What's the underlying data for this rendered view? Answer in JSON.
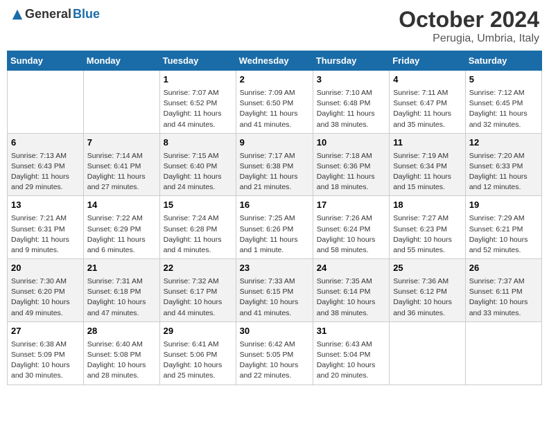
{
  "logo": {
    "general": "General",
    "blue": "Blue"
  },
  "header": {
    "month": "October 2024",
    "location": "Perugia, Umbria, Italy"
  },
  "days_of_week": [
    "Sunday",
    "Monday",
    "Tuesday",
    "Wednesday",
    "Thursday",
    "Friday",
    "Saturday"
  ],
  "weeks": [
    [
      {
        "day": null,
        "info": null
      },
      {
        "day": null,
        "info": null
      },
      {
        "day": "1",
        "info": "Sunrise: 7:07 AM\nSunset: 6:52 PM\nDaylight: 11 hours and 44 minutes."
      },
      {
        "day": "2",
        "info": "Sunrise: 7:09 AM\nSunset: 6:50 PM\nDaylight: 11 hours and 41 minutes."
      },
      {
        "day": "3",
        "info": "Sunrise: 7:10 AM\nSunset: 6:48 PM\nDaylight: 11 hours and 38 minutes."
      },
      {
        "day": "4",
        "info": "Sunrise: 7:11 AM\nSunset: 6:47 PM\nDaylight: 11 hours and 35 minutes."
      },
      {
        "day": "5",
        "info": "Sunrise: 7:12 AM\nSunset: 6:45 PM\nDaylight: 11 hours and 32 minutes."
      }
    ],
    [
      {
        "day": "6",
        "info": "Sunrise: 7:13 AM\nSunset: 6:43 PM\nDaylight: 11 hours and 29 minutes."
      },
      {
        "day": "7",
        "info": "Sunrise: 7:14 AM\nSunset: 6:41 PM\nDaylight: 11 hours and 27 minutes."
      },
      {
        "day": "8",
        "info": "Sunrise: 7:15 AM\nSunset: 6:40 PM\nDaylight: 11 hours and 24 minutes."
      },
      {
        "day": "9",
        "info": "Sunrise: 7:17 AM\nSunset: 6:38 PM\nDaylight: 11 hours and 21 minutes."
      },
      {
        "day": "10",
        "info": "Sunrise: 7:18 AM\nSunset: 6:36 PM\nDaylight: 11 hours and 18 minutes."
      },
      {
        "day": "11",
        "info": "Sunrise: 7:19 AM\nSunset: 6:34 PM\nDaylight: 11 hours and 15 minutes."
      },
      {
        "day": "12",
        "info": "Sunrise: 7:20 AM\nSunset: 6:33 PM\nDaylight: 11 hours and 12 minutes."
      }
    ],
    [
      {
        "day": "13",
        "info": "Sunrise: 7:21 AM\nSunset: 6:31 PM\nDaylight: 11 hours and 9 minutes."
      },
      {
        "day": "14",
        "info": "Sunrise: 7:22 AM\nSunset: 6:29 PM\nDaylight: 11 hours and 6 minutes."
      },
      {
        "day": "15",
        "info": "Sunrise: 7:24 AM\nSunset: 6:28 PM\nDaylight: 11 hours and 4 minutes."
      },
      {
        "day": "16",
        "info": "Sunrise: 7:25 AM\nSunset: 6:26 PM\nDaylight: 11 hours and 1 minute."
      },
      {
        "day": "17",
        "info": "Sunrise: 7:26 AM\nSunset: 6:24 PM\nDaylight: 10 hours and 58 minutes."
      },
      {
        "day": "18",
        "info": "Sunrise: 7:27 AM\nSunset: 6:23 PM\nDaylight: 10 hours and 55 minutes."
      },
      {
        "day": "19",
        "info": "Sunrise: 7:29 AM\nSunset: 6:21 PM\nDaylight: 10 hours and 52 minutes."
      }
    ],
    [
      {
        "day": "20",
        "info": "Sunrise: 7:30 AM\nSunset: 6:20 PM\nDaylight: 10 hours and 49 minutes."
      },
      {
        "day": "21",
        "info": "Sunrise: 7:31 AM\nSunset: 6:18 PM\nDaylight: 10 hours and 47 minutes."
      },
      {
        "day": "22",
        "info": "Sunrise: 7:32 AM\nSunset: 6:17 PM\nDaylight: 10 hours and 44 minutes."
      },
      {
        "day": "23",
        "info": "Sunrise: 7:33 AM\nSunset: 6:15 PM\nDaylight: 10 hours and 41 minutes."
      },
      {
        "day": "24",
        "info": "Sunrise: 7:35 AM\nSunset: 6:14 PM\nDaylight: 10 hours and 38 minutes."
      },
      {
        "day": "25",
        "info": "Sunrise: 7:36 AM\nSunset: 6:12 PM\nDaylight: 10 hours and 36 minutes."
      },
      {
        "day": "26",
        "info": "Sunrise: 7:37 AM\nSunset: 6:11 PM\nDaylight: 10 hours and 33 minutes."
      }
    ],
    [
      {
        "day": "27",
        "info": "Sunrise: 6:38 AM\nSunset: 5:09 PM\nDaylight: 10 hours and 30 minutes."
      },
      {
        "day": "28",
        "info": "Sunrise: 6:40 AM\nSunset: 5:08 PM\nDaylight: 10 hours and 28 minutes."
      },
      {
        "day": "29",
        "info": "Sunrise: 6:41 AM\nSunset: 5:06 PM\nDaylight: 10 hours and 25 minutes."
      },
      {
        "day": "30",
        "info": "Sunrise: 6:42 AM\nSunset: 5:05 PM\nDaylight: 10 hours and 22 minutes."
      },
      {
        "day": "31",
        "info": "Sunrise: 6:43 AM\nSunset: 5:04 PM\nDaylight: 10 hours and 20 minutes."
      },
      {
        "day": null,
        "info": null
      },
      {
        "day": null,
        "info": null
      }
    ]
  ]
}
